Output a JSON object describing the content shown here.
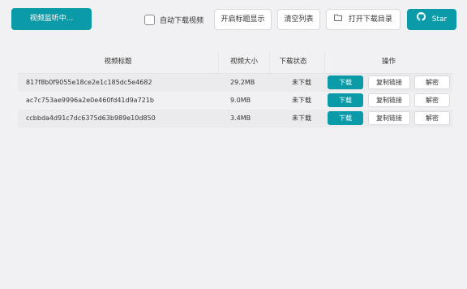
{
  "toolbar": {
    "monitor_button": "视频监听中...",
    "auto_download_label": "自动下载视频",
    "show_title_button": "开启标题显示",
    "clear_list_button": "清空列表",
    "open_dir_button": "打开下载目录",
    "star_button": "Star"
  },
  "table": {
    "headers": {
      "title": "视频标题",
      "size": "视频大小",
      "status": "下载状态",
      "actions": "操作"
    },
    "rows": [
      {
        "title": "817f8b0f9055e18ce2e1c185dc5e4682",
        "size": "29.2MB",
        "status": "未下载",
        "download": "下载",
        "copy": "复制链接",
        "decrypt": "解密"
      },
      {
        "title": "ac7c753ae9996a2e0e460fd41d9a721b",
        "size": "9.0MB",
        "status": "未下载",
        "download": "下载",
        "copy": "复制链接",
        "decrypt": "解密"
      },
      {
        "title": "ccbbda4d91c7dc6375d63b989e10d850",
        "size": "3.4MB",
        "status": "未下载",
        "download": "下载",
        "copy": "复制链接",
        "decrypt": "解密"
      }
    ]
  },
  "colors": {
    "accent": "#0a9aa8",
    "background": "#f1f1f3"
  },
  "icons": {
    "folder": "folder-icon",
    "github": "github-icon"
  }
}
